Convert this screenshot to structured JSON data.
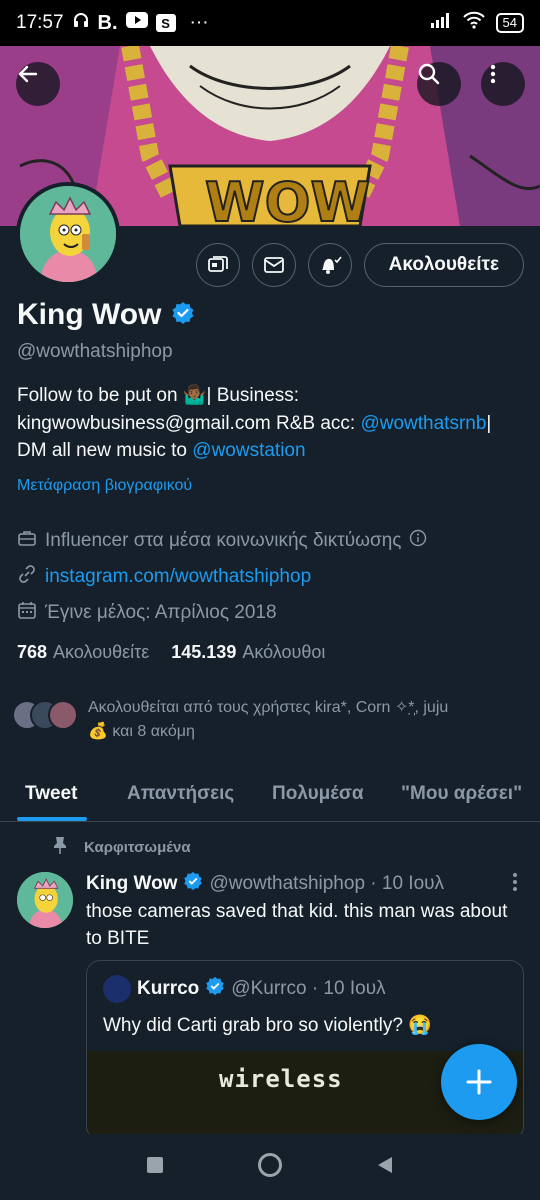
{
  "status_bar": {
    "time": "17:57",
    "app_letter": "B.",
    "s_badge": "S",
    "more": "···",
    "battery": "54"
  },
  "profile": {
    "name": "King Wow",
    "handle": "@wowthatshiphop",
    "follow_label": "Ακολουθείτε",
    "bio_part1": "Follow to be put on 🤷🏾‍♂️| Business: kingwowbusiness@gmail.com R&B acc: ",
    "bio_link1": "@wowthatsrnb",
    "bio_part2": "| DM all new music to ",
    "bio_link2": "@wowstation",
    "translate_label": "Μετάφραση βιογραφικού",
    "category": "Influencer στα μέσα κοινωνικής δικτύωσης",
    "website": "instagram.com/wowthatshiphop",
    "joined": "Έγινε μέλος: Απρίλιος 2018",
    "following_count": "768",
    "following_label": "Ακολουθείτε",
    "followers_count": "145.139",
    "followers_label": "Ακόλουθοι",
    "followed_by_line1": "Ακολουθείται από τους χρήστες kira*, Corn ✧*̣̩, juju",
    "followed_by_line2": "💰 και 8 ακόμη"
  },
  "tabs": [
    "Tweet",
    "Απαντήσεις",
    "Πολυμέσα",
    "\"Μου αρέσει\""
  ],
  "pinned_tweet": {
    "pinned_label": "Καρφιτσωμένα",
    "author": "King Wow",
    "handle_date": "@wowthatshiphop · 10 Ιουλ",
    "text": "those cameras saved that kid. this man was about to BITE",
    "quote": {
      "author": "Kurrco",
      "handle_date": "@Kurrco · 10 Ιουλ",
      "text": "Why did Carti grab bro so violently? 😭",
      "media_caption": "wireless"
    }
  },
  "colors": {
    "background": "#15202b",
    "accent": "#1d9bf0",
    "secondary_text": "#8b98a5",
    "border": "#38444d"
  }
}
